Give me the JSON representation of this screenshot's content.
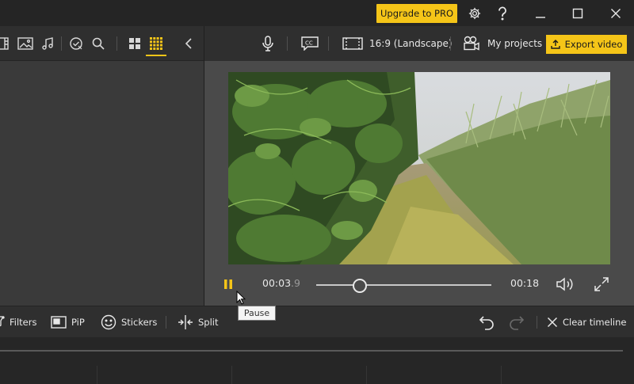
{
  "titlebar": {
    "upgrade_label": "Upgrade to PRO",
    "icons": [
      "gear-icon",
      "help-icon",
      "minimize-icon",
      "maximize-icon",
      "close-icon"
    ]
  },
  "top_toolbar": {
    "aspect_label": "16:9 (Landscape)",
    "projects_label": "My projects",
    "export_label": "Export video"
  },
  "player": {
    "current_time_main": "00:03",
    "current_time_fraction": ".9",
    "duration": "00:18",
    "progress": 0.25,
    "tooltip": "Pause"
  },
  "bottom_toolbar": {
    "filters_label": "Filters",
    "pip_label": "PiP",
    "stickers_label": "Stickers",
    "split_label": "Split",
    "clear_label": "Clear timeline"
  },
  "colors": {
    "accent": "#f5c518",
    "panel": "#3a3a3a",
    "preview_bg": "#4a4a4a",
    "toolbar": "#2f2f2f"
  }
}
